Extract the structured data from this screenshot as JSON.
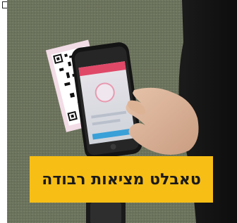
{
  "caption": {
    "text": "טאבלט מציאות רבודה"
  },
  "colors": {
    "banner": "#f7be15",
    "caption_text": "#1a1a1a",
    "background_carpet": "#6f7560",
    "phone_screen_accent": "#e04868",
    "qr_card": "#f2dce6"
  }
}
